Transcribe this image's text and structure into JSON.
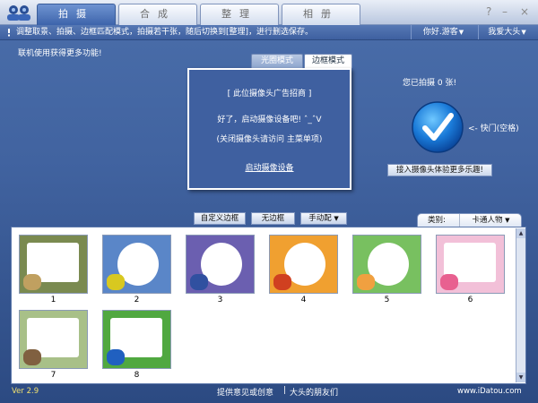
{
  "tabs": [
    {
      "label": "拍摄"
    },
    {
      "label": "合成"
    },
    {
      "label": "整理"
    },
    {
      "label": "相册"
    }
  ],
  "window": {
    "help": "?",
    "minimize": "–",
    "close": "×"
  },
  "info": {
    "text": "调整取景、拍摄、边框匹配模式，拍摄若干张，随后切换到[整理]，进行删选保存。"
  },
  "greet": {
    "label": "你好.游客",
    "arrow": "▼"
  },
  "user": {
    "label": "我爱大头",
    "arrow": "▼"
  },
  "hint": "联机使用获得更多功能!",
  "modes": {
    "light": "光圈模式",
    "frame": "边框模式"
  },
  "camera": {
    "ad": "[ 此位摄像头广告招商 ]",
    "line1": "好了，启动摄像设备吧! ˆ_ˆV",
    "line2": "(关闭摄像头请访问 主菜单项)",
    "start": "启动摄像设备"
  },
  "shots_text": "您已拍摄 0 张!",
  "shutter_label": "<- 快门(空格)",
  "connect_label": "接入摄像头体验更多乐趣!",
  "buttons": {
    "custom": "自定义边框",
    "no_frame": "无边框",
    "manual": "手动配"
  },
  "category": {
    "label": "类别:",
    "value": "卡通人物",
    "arrow": "▼"
  },
  "thumbs": [
    {
      "caption": "1",
      "bg": "#7a8a50",
      "inner": "#ffffff",
      "accent": "#c0a060"
    },
    {
      "caption": "2",
      "bg": "#5a86c8",
      "inner": "#ffffff",
      "accent": "#d8c820"
    },
    {
      "caption": "3",
      "bg": "#6b5fb0",
      "inner": "#ffffff",
      "accent": "#3050a0"
    },
    {
      "caption": "4",
      "bg": "#f0a030",
      "inner": "#ffffff",
      "accent": "#d04020"
    },
    {
      "caption": "5",
      "bg": "#78c060",
      "inner": "#ffffff",
      "accent": "#f0a040"
    },
    {
      "caption": "6",
      "bg": "#f2c0d8",
      "inner": "#ffffff",
      "accent": "#e86090"
    },
    {
      "caption": "7",
      "bg": "#a8c088",
      "inner": "#ffffff",
      "accent": "#806040"
    },
    {
      "caption": "8",
      "bg": "#50a840",
      "inner": "#ffffff",
      "accent": "#2060c0"
    }
  ],
  "footer": {
    "version": "Ver 2.9",
    "feedback": "提供意见或创意",
    "sep": "|",
    "friends": "大头的朋友们",
    "site": "www.iDatou.com"
  }
}
